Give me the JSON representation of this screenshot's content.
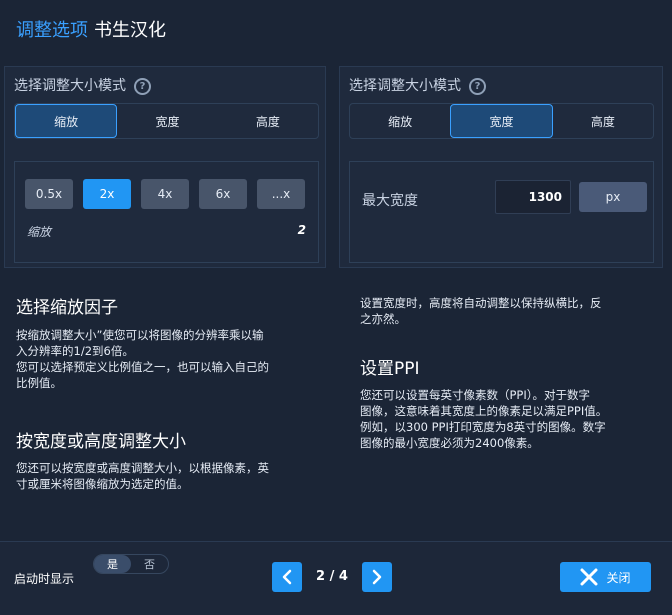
{
  "header": {
    "title_accent": "调整选项",
    "title_sub": "书生汉化"
  },
  "left_panel": {
    "title": "选择调整大小模式",
    "help_icon": "?",
    "tabs": [
      "缩放",
      "宽度",
      "高度"
    ],
    "active_tab": "缩放",
    "scale_options": [
      "0.5x",
      "2x",
      "4x",
      "6x",
      "...x"
    ],
    "selected_scale": "2x",
    "scale_label": "缩放",
    "scale_value": "2"
  },
  "right_panel": {
    "title": "选择调整大小模式",
    "help_icon": "?",
    "tabs": [
      "缩放",
      "宽度",
      "高度"
    ],
    "active_tab": "宽度",
    "max_width_label": "最大宽度",
    "max_width_value": "1300",
    "unit": "px"
  },
  "left_text": {
    "h1": "选择缩放因子",
    "p1": [
      "按缩放调整大小”使您可以将图像的分辨率乘以输",
      "入分辨率的1/2到6倍。",
      "您可以选择预定义比例值之一，也可以输入自己的",
      "比例值。"
    ],
    "h2": "按宽度或高度调整大小",
    "p2": [
      "您还可以按宽度或高度调整大小，以根据像素，英",
      "寸或厘米将图像缩放为选定的值。"
    ]
  },
  "right_text": {
    "p1": [
      "设置宽度时，高度将自动调整以保持纵横比，反",
      "之亦然。"
    ],
    "h1": "设置PPI",
    "p2": [
      "您还可以设置每英寸像素数（PPI）。对于数字",
      "图像，这意味着其宽度上的像素足以满足PPI值。",
      "例如，以300 PPI打印宽度为8英寸的图像。数字",
      "图像的最小宽度必须为2400像素。"
    ]
  },
  "footer": {
    "startup_label": "启动时显示",
    "toggle_on": "是",
    "toggle_off": "否",
    "page_indicator": "2 / 4",
    "close_label": "关闭"
  },
  "colors": {
    "accent": "#2196f3",
    "title_accent": "#3aa0ff",
    "background": "#1b2536"
  }
}
